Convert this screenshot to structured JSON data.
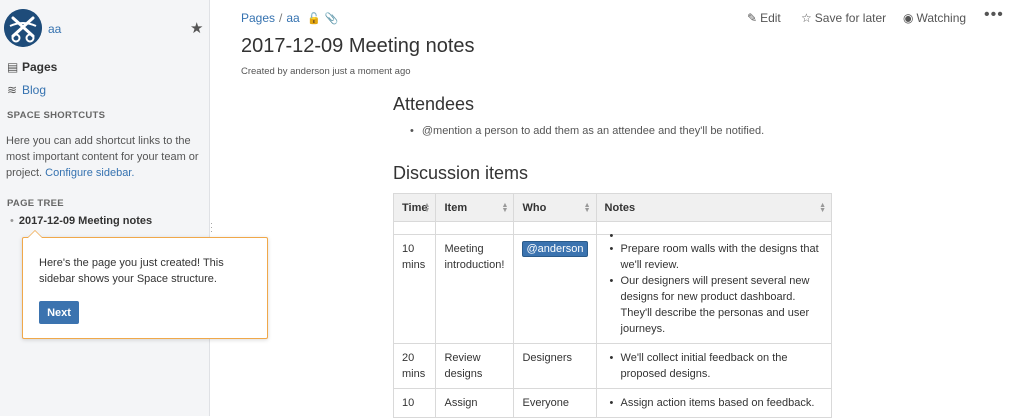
{
  "space": {
    "name": "aa",
    "logo_icon": "scissors-logo-icon"
  },
  "sidebar": {
    "pages_label": "Pages",
    "blog_label": "Blog",
    "shortcuts_heading": "SPACE SHORTCUTS",
    "shortcuts_text": "Here you can add shortcut links to the most important content for your team or project.",
    "configure_link": "Configure sidebar.",
    "tree_heading": "PAGE TREE",
    "tree_item": "2017-12-09 Meeting notes"
  },
  "tooltip": {
    "text": "Here's the page you just created! This sidebar shows your Space structure.",
    "button": "Next"
  },
  "breadcrumb": {
    "root": "Pages",
    "separator": "/",
    "space": "aa"
  },
  "actions": {
    "edit": "Edit",
    "save": "Save for later",
    "watch": "Watching",
    "more": "•••"
  },
  "page": {
    "title": "2017-12-09 Meeting notes",
    "byline": "Created by anderson just a moment ago",
    "attendees_heading": "Attendees",
    "attendee_hint": "@mention a person to add them as an attendee and they'll be notified.",
    "discussion_heading": "Discussion items"
  },
  "table": {
    "headers": [
      "Time",
      "Item",
      "Who",
      "Notes"
    ],
    "rows": [
      {
        "time": "",
        "item": "",
        "who": "",
        "notes": [
          ""
        ]
      },
      {
        "time": "10 mins",
        "item": "Meeting introduction!",
        "who": "@anderson",
        "notes": [
          "Prepare room walls with the designs that we'll review.",
          "Our designers will present several new designs for new product dashboard. They'll describe the personas and user journeys."
        ]
      },
      {
        "time": "20 mins",
        "item": "Review designs",
        "who": "Designers",
        "notes": [
          "We'll collect initial feedback on the proposed designs."
        ]
      },
      {
        "time": "10",
        "item": "Assign",
        "who": "Everyone",
        "notes": [
          "Assign action items based on feedback."
        ]
      }
    ]
  },
  "colors": {
    "link": "#3572b0",
    "tooltip_border": "#f0a84a",
    "button": "#3b73af"
  }
}
